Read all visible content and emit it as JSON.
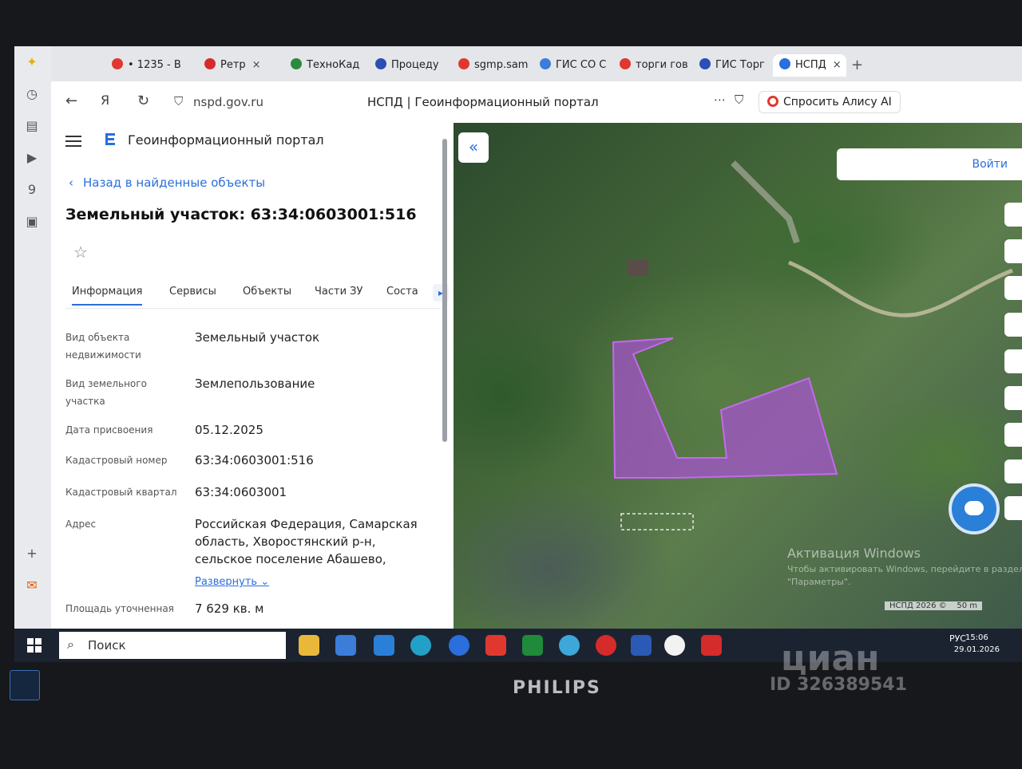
{
  "browser": {
    "tabs": [
      {
        "label": "• 1235 - В",
        "color": "#e0382f"
      },
      {
        "label": "Ретр",
        "color": "#d62b2b"
      },
      {
        "label": "ТехноКад",
        "color": "#2c8a3e"
      },
      {
        "label": "Процеду",
        "color": "#2a4fb5"
      },
      {
        "label": "sgmp.sam",
        "color": "#e0382f"
      },
      {
        "label": "ГИС СО С",
        "color": "#3b7dd8"
      },
      {
        "label": "торги гов",
        "color": "#e0382f"
      },
      {
        "label": "ГИС Торг",
        "color": "#2a4fb5"
      },
      {
        "label": "НСПД",
        "color": "#2a6fdb"
      }
    ],
    "tab_close": "×",
    "new_tab": "+",
    "url_domain": "nspd.gov.ru",
    "page_title": "НСПД | Геоинформационный портал",
    "alisa_button": "Спросить Алису AI"
  },
  "portal": {
    "title": "Геоинформационный портал",
    "back_link": "Назад в найденные объекты",
    "object_title": "Земельный участок: 63:34:0603001:516",
    "tabs": [
      "Информация",
      "Сервисы",
      "Объекты",
      "Части ЗУ",
      "Соста"
    ],
    "rows": [
      {
        "label": "Вид объекта недвижимости",
        "value": "Земельный участок"
      },
      {
        "label": "Вид земельного участка",
        "value": "Землепользование"
      },
      {
        "label": "Дата присвоения",
        "value": "05.12.2025"
      },
      {
        "label": "Кадастровый номер",
        "value": "63:34:0603001:516"
      },
      {
        "label": "Кадастровый квартал",
        "value": "63:34:0603001"
      },
      {
        "label": "Адрес",
        "value": "Российская Федерация, Самарская область, Хворостянский р-н, сельское поселение Абашево,"
      },
      {
        "label": "Площадь уточненная",
        "value": "7 629 кв. м"
      }
    ],
    "expand_link": "Развернуть"
  },
  "map": {
    "login": "Войти",
    "watermark_title": "Активация Windows",
    "watermark_text": "Чтобы активировать Windows, перейдите в раздел \"Параметры\".",
    "copyright": "НСПД 2026 ©",
    "scale": "50 m",
    "parcel_color": "#b04de0"
  },
  "taskbar": {
    "search": "Поиск",
    "lang": "РУС",
    "time": "15:06",
    "date": "29.01.2026"
  },
  "bezel": {
    "brand": "PHILIPS",
    "cian": "циан",
    "cian_id": "ID 326389541"
  }
}
